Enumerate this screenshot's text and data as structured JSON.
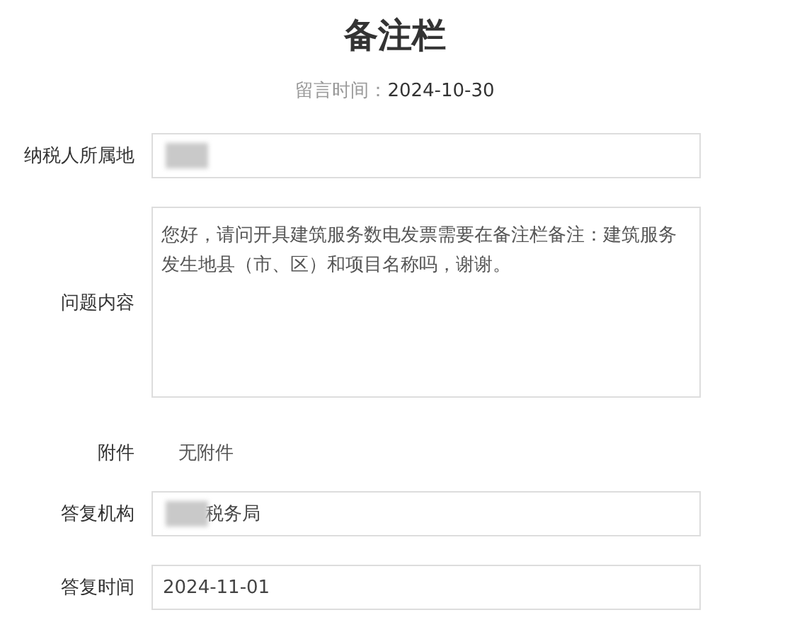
{
  "title": "备注栏",
  "meta": {
    "label": "留言时间：",
    "value": "2024-10-30"
  },
  "fields": [
    {
      "kind": "input",
      "label": "纳税人所属地",
      "redacted": true
    },
    {
      "kind": "textarea",
      "label": "问题内容",
      "value": "您好，请问开具建筑服务数电发票需要在备注栏备注：建筑服务发生地县（市、区）和项目名称吗，谢谢。"
    },
    {
      "kind": "plain",
      "label": "附件",
      "value": "无附件"
    },
    {
      "kind": "input",
      "label": "答复机构",
      "value": "税务局",
      "redacted": true
    },
    {
      "kind": "input",
      "label": "答复时间",
      "value": "2024-11-01"
    }
  ]
}
